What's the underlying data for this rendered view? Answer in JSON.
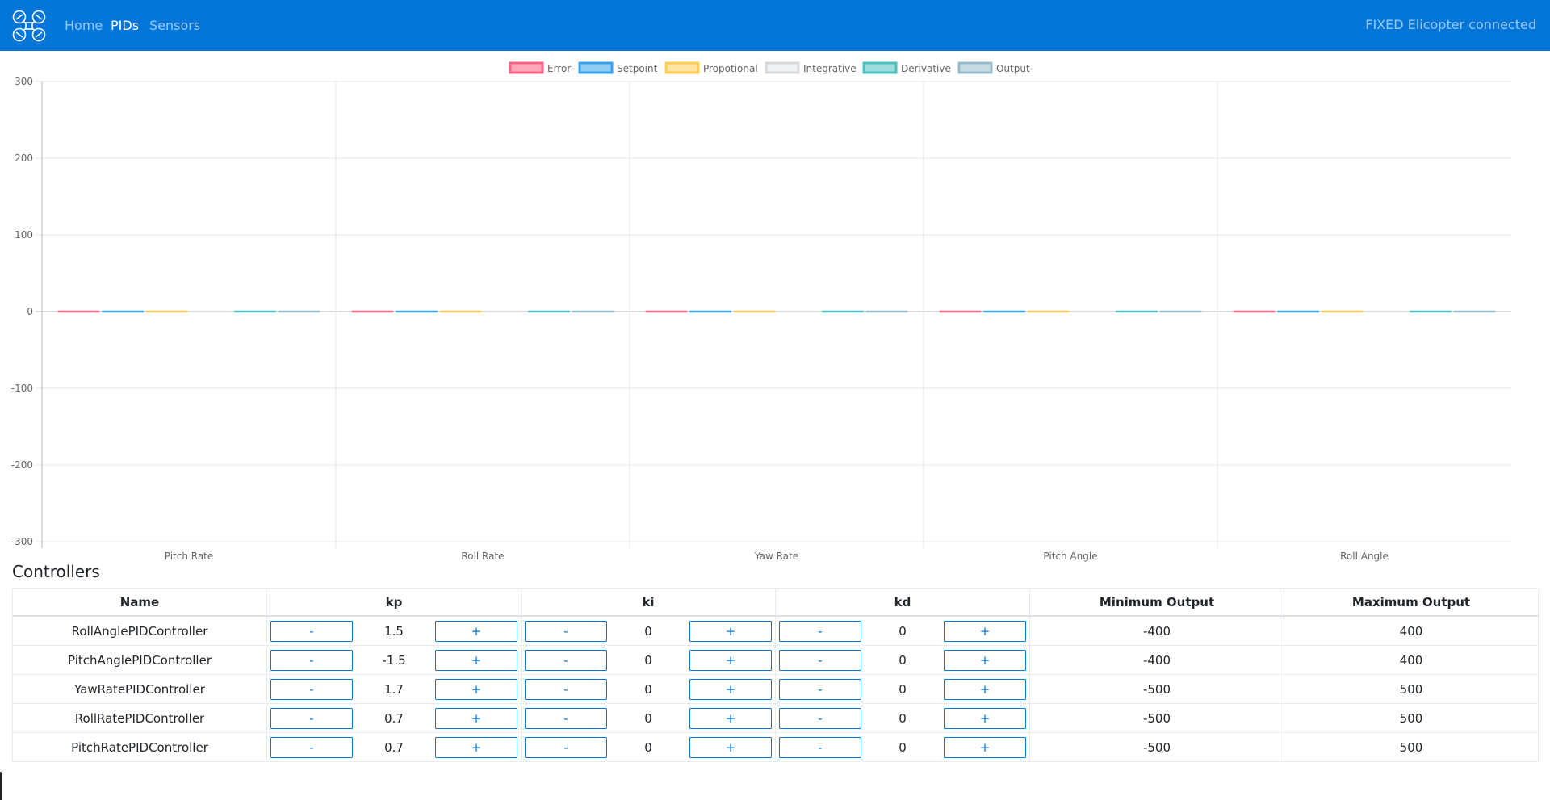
{
  "nav": {
    "links": [
      {
        "label": "Home",
        "active": false
      },
      {
        "label": "PIDs",
        "active": true
      },
      {
        "label": "Sensors",
        "active": false
      }
    ],
    "status": "FIXED Elicopter connected"
  },
  "chart_data": {
    "type": "bar",
    "categories": [
      "Pitch Rate",
      "Roll Rate",
      "Yaw Rate",
      "Pitch Angle",
      "Roll Angle"
    ],
    "ylim": [
      -300,
      300
    ],
    "yticks": [
      300,
      200,
      100,
      0,
      -100,
      -200,
      -300
    ],
    "grid": true,
    "legend_position": "top",
    "series": [
      {
        "name": "Error",
        "color": "#ff6384",
        "values": [
          0,
          0,
          0,
          0,
          0
        ]
      },
      {
        "name": "Setpoint",
        "color": "#36a2eb",
        "values": [
          0,
          0,
          0,
          0,
          0
        ]
      },
      {
        "name": "Propotional",
        "color": "#ffcd56",
        "values": [
          0,
          0,
          0,
          0,
          0
        ]
      },
      {
        "name": "Integrative",
        "color": "#e4e5e7",
        "values": [
          0,
          0,
          0,
          0,
          0
        ]
      },
      {
        "name": "Derivative",
        "color": "#4bc0c0",
        "values": [
          0,
          0,
          0,
          0,
          0
        ]
      },
      {
        "name": "Output",
        "color": "#97bbcd",
        "values": [
          0,
          0,
          0,
          0,
          0
        ]
      }
    ]
  },
  "controllers": {
    "title": "Controllers",
    "headers": [
      "Name",
      "kp",
      "ki",
      "kd",
      "Minimum Output",
      "Maximum Output"
    ],
    "minus_label": "-",
    "plus_label": "+",
    "rows": [
      {
        "name": "RollAnglePIDController",
        "kp": "1.5",
        "ki": "0",
        "kd": "0",
        "min": "-400",
        "max": "400"
      },
      {
        "name": "PitchAnglePIDController",
        "kp": "-1.5",
        "ki": "0",
        "kd": "0",
        "min": "-400",
        "max": "400"
      },
      {
        "name": "YawRatePIDController",
        "kp": "1.7",
        "ki": "0",
        "kd": "0",
        "min": "-500",
        "max": "500"
      },
      {
        "name": "RollRatePIDController",
        "kp": "0.7",
        "ki": "0",
        "kd": "0",
        "min": "-500",
        "max": "500"
      },
      {
        "name": "PitchRatePIDController",
        "kp": "0.7",
        "ki": "0",
        "kd": "0",
        "min": "-500",
        "max": "500"
      }
    ]
  }
}
